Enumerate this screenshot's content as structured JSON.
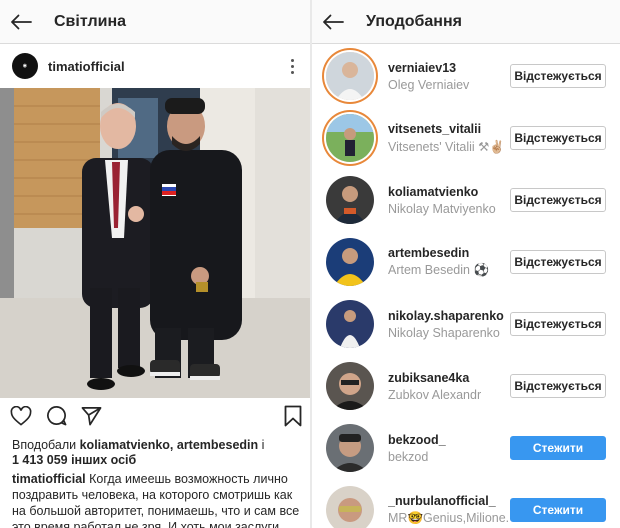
{
  "left": {
    "header": {
      "title": "Світлина"
    },
    "post": {
      "username": "timatiofficial",
      "likes_line1_prefix": "Вподобали ",
      "likes_users": "koliamatvienko, artembesedin",
      "likes_line1_suffix": " і",
      "likes_count": "1 413 059 інших осіб",
      "caption_user": "timatiofficial",
      "caption_text": " Когда имеешь возможность лично поздравить человека, на которого смотришь как на большой авторитет, понимаешь, что и сам все это время работал не зря. И хоть мои заслуги"
    }
  },
  "right": {
    "header": {
      "title": "Уподобання"
    },
    "users": [
      {
        "username": "verniaiev13",
        "full_name": "Oleg Verniaiev",
        "button": "Відстежується",
        "following": true
      },
      {
        "username": "vitsenets_vitalii",
        "full_name": "Vitsenets' Vitalii ⚒✌🏼",
        "button": "Відстежується",
        "following": true
      },
      {
        "username": "koliamatvienko",
        "full_name": "Nikolay Matviyenko",
        "button": "Відстежується",
        "following": true
      },
      {
        "username": "artembesedin",
        "full_name": "Artem Besedin ⚽",
        "button": "Відстежується",
        "following": true
      },
      {
        "username": "nikolay.shaparenko",
        "full_name": "Nikolay Shaparenko",
        "button": "Відстежується",
        "following": true
      },
      {
        "username": "zubiksane4ka",
        "full_name": "Zubkov Alexandr",
        "button": "Відстежується",
        "following": true
      },
      {
        "username": "bekzood_",
        "full_name": "bekzod",
        "button": "Стежити",
        "following": false
      },
      {
        "username": "_nurbulanofficial_",
        "full_name": "MR🤓Genius,Milione...",
        "button": "Стежити",
        "following": false
      }
    ]
  },
  "colors": {
    "accent_blue": "#3897f0",
    "muted_text": "#999999",
    "story_ring": "#e8883a"
  }
}
